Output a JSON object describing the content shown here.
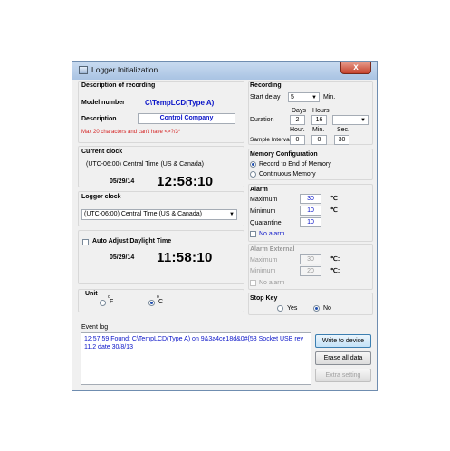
{
  "window": {
    "title": "Logger Initialization",
    "close_glyph": "x"
  },
  "description_section": {
    "header": "Description of recording",
    "model_label": "Model number",
    "model_value": "C\\TempLCD(Type A)",
    "description_label": "Description",
    "description_value": "Control Company",
    "warning": "Max 20 characters and can't have <>?/3*"
  },
  "current_clock": {
    "header": "Current clock",
    "timezone": "(UTC-06:00) Central Time (US & Canada)",
    "date": "05/29/14",
    "time": "12:58:10"
  },
  "logger_clock": {
    "header": "Logger clock",
    "timezone": "(UTC-06:00) Central Time (US & Canada)",
    "auto_adjust_label": "Auto Adjust Daylight Time",
    "auto_adjust_checked": false,
    "date": "05/29/14",
    "time": "11:58:10"
  },
  "unit": {
    "header": "Unit",
    "f_label": "F",
    "c_label": "C",
    "degree": "o",
    "selected": "C"
  },
  "recording": {
    "header": "Recording",
    "start_delay_label": "Start delay",
    "start_delay_value": "5",
    "start_delay_unit": "Min.",
    "days_label": "Days",
    "hours_label": "Hours",
    "duration_label": "Duration",
    "days_value": "2",
    "hours_value": "16",
    "hour_label": "Hour.",
    "min_label": "Min.",
    "sec_label": "Sec.",
    "sample_interval_label": "Sample Interval:",
    "hour_value": "0",
    "min_value": "0",
    "sec_value": "30"
  },
  "memory": {
    "header": "Memory Configuration",
    "option1": "Record to End of Memory",
    "option2": "Continuous Memory",
    "selected": "option1"
  },
  "alarm": {
    "header": "Alarm",
    "max_label": "Maximum",
    "max_value": "30",
    "min_label": "Minimum",
    "min_value": "10",
    "quarantine_label": "Quarantine",
    "quarantine_value": "10",
    "unit": "℃",
    "no_alarm_label": "No alarm"
  },
  "alarm_external": {
    "header": "Alarm External",
    "max_label": "Maximum",
    "max_value": "30",
    "min_label": "Minimum",
    "min_value": "20",
    "unit": "℃:",
    "no_alarm_label": "No alarm"
  },
  "stop_key": {
    "header": "Stop Key",
    "yes_label": "Yes",
    "no_label": "No",
    "selected": "No"
  },
  "event_log": {
    "header": "Event log",
    "text": "12:57:59 Found: C\\TempLCD(Type A) on 9&3a4ce18d&0#{53 Socket USB rev 11.2 date 30/8/13"
  },
  "buttons": {
    "write": "Write to device",
    "erase": "Erase all data",
    "extra": "Extra setting"
  }
}
